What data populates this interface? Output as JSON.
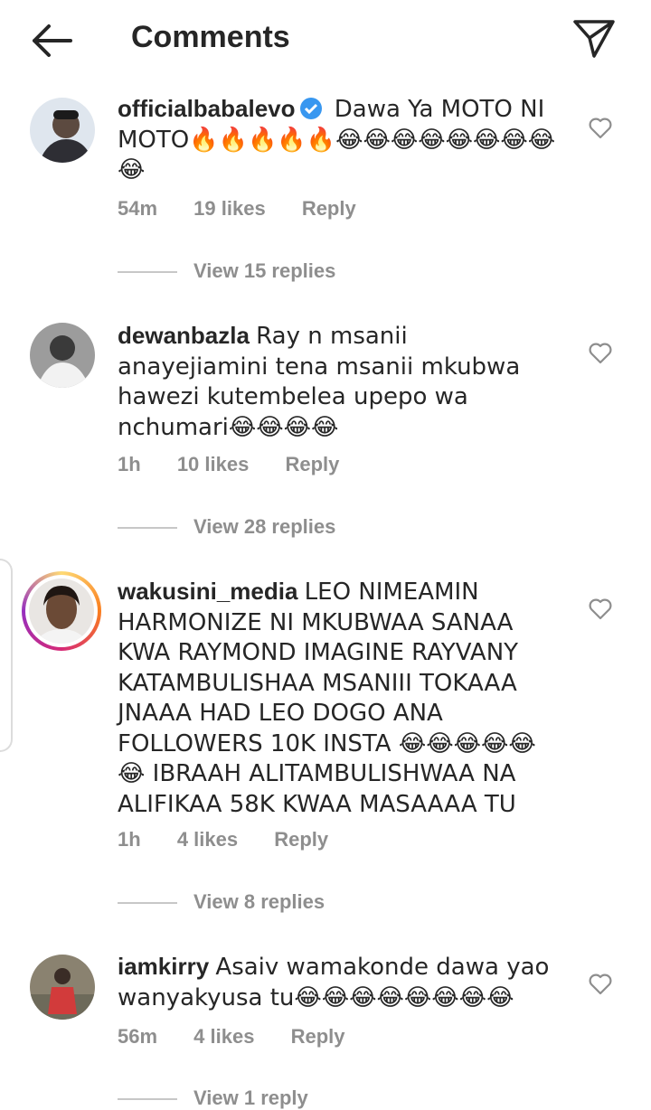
{
  "header": {
    "title": "Comments",
    "back_icon": "arrow-left-icon",
    "share_icon": "paper-plane-icon"
  },
  "comments": [
    {
      "username": "officialbabalevo",
      "verified": true,
      "text": "Dawa Ya MOTO NI MOTO🔥🔥🔥🔥🔥😂😂😂😂😂😂😂😂😂",
      "time": "54m",
      "likes": "19 likes",
      "reply": "Reply",
      "view_replies": "View 15 replies"
    },
    {
      "username": "dewanbazla",
      "verified": false,
      "text": "Ray n msanii anayejiamini tena msanii mkubwa hawezi kutembelea upepo wa nchumari😂😂😂😂",
      "time": "1h",
      "likes": "10 likes",
      "reply": "Reply",
      "view_replies": "View 28 replies"
    },
    {
      "username": "wakusini_media",
      "verified": false,
      "text": "LEO NIMEAMIN HARMONIZE NI MKUBWAA SANAA KWA RAYMOND IMAGINE RAYVANY KATAMBULISHAA MSANIII TOKAAA JNAAA HAD LEO DOGO ANA FOLLOWERS 10K INSTA 😂😂😂😂😂😂 IBRAAH ALITAMBULISHWAA NA ALIFIKAA 58K KWAA MASAAAA TU",
      "time": "1h",
      "likes": "4 likes",
      "reply": "Reply",
      "view_replies": "View 8 replies"
    },
    {
      "username": "iamkirry",
      "verified": false,
      "text": "Asaiv wamakonde dawa yao wanyakyusa tu😂😂😂😂😂😂😂😂",
      "time": "56m",
      "likes": "4 likes",
      "reply": "Reply",
      "view_replies": "View 1 reply"
    }
  ],
  "colors": {
    "text": "#262626",
    "muted": "#8e8e8e",
    "verified": "#3897f0",
    "story_ring": "#e1306c"
  }
}
